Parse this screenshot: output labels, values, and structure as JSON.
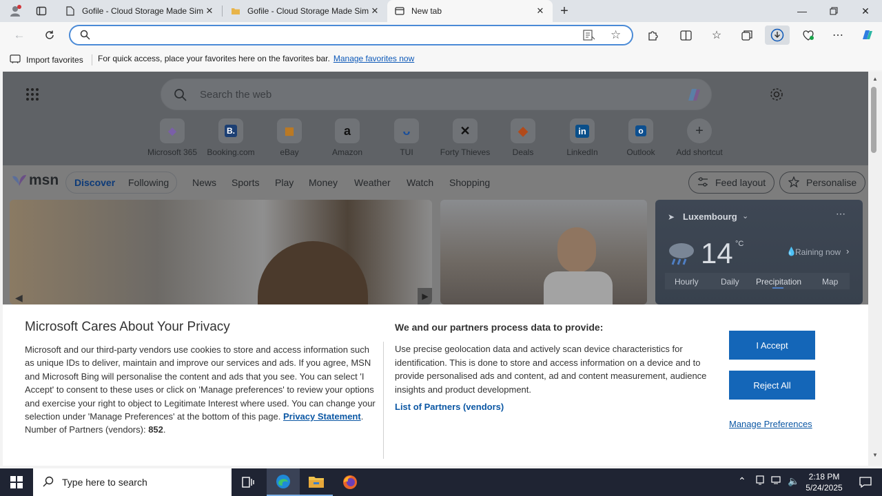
{
  "tabs": [
    {
      "label": "Gofile - Cloud Storage Made Sim",
      "close": "✕"
    },
    {
      "label": "Gofile - Cloud Storage Made Sim",
      "close": "✕"
    },
    {
      "label": "New tab",
      "close": "✕"
    }
  ],
  "address_bar": {
    "value": "",
    "placeholder": ""
  },
  "favorites_bar": {
    "import_label": "Import favorites",
    "hint": "For quick access, place your favorites here on the favorites bar.",
    "manage_link": "Manage favorites now"
  },
  "newtab": {
    "search_placeholder": "Search the web",
    "shortcuts": [
      {
        "name": "Microsoft 365",
        "glyph": "◆",
        "color": "#7a5fa8"
      },
      {
        "name": "Booking.com",
        "glyph": "B.",
        "color": "#1c3f73"
      },
      {
        "name": "eBay",
        "glyph": "▦",
        "color": "#c47a1a"
      },
      {
        "name": "Amazon",
        "glyph": "a",
        "color": "#111111"
      },
      {
        "name": "TUI",
        "glyph": "ᴗ",
        "color": "#1a4f9a"
      },
      {
        "name": "Forty Thieves",
        "glyph": "✕",
        "color": "#111111"
      },
      {
        "name": "Deals",
        "glyph": "◆",
        "color": "#b24a1a"
      },
      {
        "name": "LinkedIn",
        "glyph": "in",
        "color": "#0a4f8a"
      },
      {
        "name": "Outlook",
        "glyph": "o",
        "color": "#0d4f8f"
      },
      {
        "name": "Add shortcut",
        "glyph": "+",
        "color": "#2a2d30"
      }
    ],
    "msn": {
      "logo": "msn",
      "tabs": [
        "Discover",
        "Following"
      ],
      "links": [
        "News",
        "Sports",
        "Play",
        "Money",
        "Weather",
        "Watch",
        "Shopping"
      ],
      "feed_layout": "Feed layout",
      "personalise": "Personalise"
    },
    "weather": {
      "location": "Luxembourg",
      "temp": "14",
      "unit": "°C",
      "condition": "Raining now",
      "tabs": [
        "Hourly",
        "Daily",
        "Precipitation",
        "Map"
      ]
    }
  },
  "privacy": {
    "title": "Microsoft Cares About Your Privacy",
    "body": "Microsoft and our third-party vendors use cookies to store and access information such as unique IDs to deliver, maintain and improve our services and ads. If you agree, MSN and Microsoft Bing will personalise the content and ads that you see. You can select 'I Accept' to consent to these uses or click on 'Manage preferences' to review your options and exercise your right to object to Legitimate Interest where used.  You can change your selection under 'Manage Preferences' at the bottom of this page.",
    "privacy_link": "Privacy Statement",
    "partners_label": "Number of Partners (vendors):",
    "partners_count": "852",
    "right_title": "We and our partners process data to provide:",
    "right_body": "Use precise geolocation data and actively scan device characteristics for identification. This is done to store and access information on a device and to provide personalised ads and content, ad and content measurement, audience insights and product development.",
    "vendors_link": "List of Partners (vendors)",
    "accept": "I Accept",
    "reject": "Reject All",
    "manage": "Manage Preferences"
  },
  "taskbar": {
    "search_placeholder": "Type here to search",
    "time": "2:18 PM",
    "date": "5/24/2025"
  }
}
